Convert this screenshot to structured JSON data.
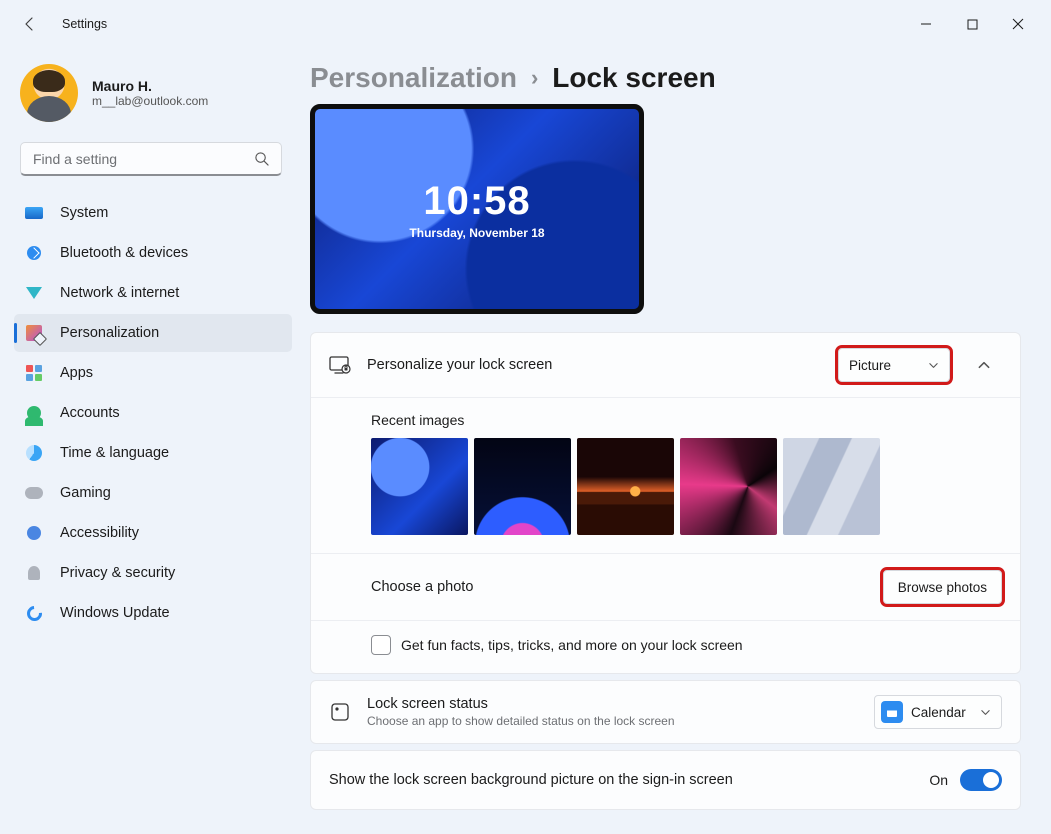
{
  "window": {
    "app_title": "Settings"
  },
  "user": {
    "name": "Mauro H.",
    "email": "m__lab@outlook.com"
  },
  "search": {
    "placeholder": "Find a setting"
  },
  "nav": {
    "items": [
      {
        "label": "System"
      },
      {
        "label": "Bluetooth & devices"
      },
      {
        "label": "Network & internet"
      },
      {
        "label": "Personalization"
      },
      {
        "label": "Apps"
      },
      {
        "label": "Accounts"
      },
      {
        "label": "Time & language"
      },
      {
        "label": "Gaming"
      },
      {
        "label": "Accessibility"
      },
      {
        "label": "Privacy & security"
      },
      {
        "label": "Windows Update"
      }
    ]
  },
  "breadcrumb": {
    "parent": "Personalization",
    "current": "Lock screen"
  },
  "preview": {
    "time": "10:58",
    "date": "Thursday, November 18"
  },
  "personalize": {
    "title": "Personalize your lock screen",
    "dropdown_value": "Picture",
    "recent_title": "Recent images",
    "choose_label": "Choose a photo",
    "browse_button": "Browse photos",
    "funfacts_label": "Get fun facts, tips, tricks, and more on your lock screen"
  },
  "status": {
    "title": "Lock screen status",
    "sub": "Choose an app to show detailed status on the lock screen",
    "app_label": "Calendar"
  },
  "signin": {
    "label": "Show the lock screen background picture on the sign-in screen",
    "state": "On"
  }
}
